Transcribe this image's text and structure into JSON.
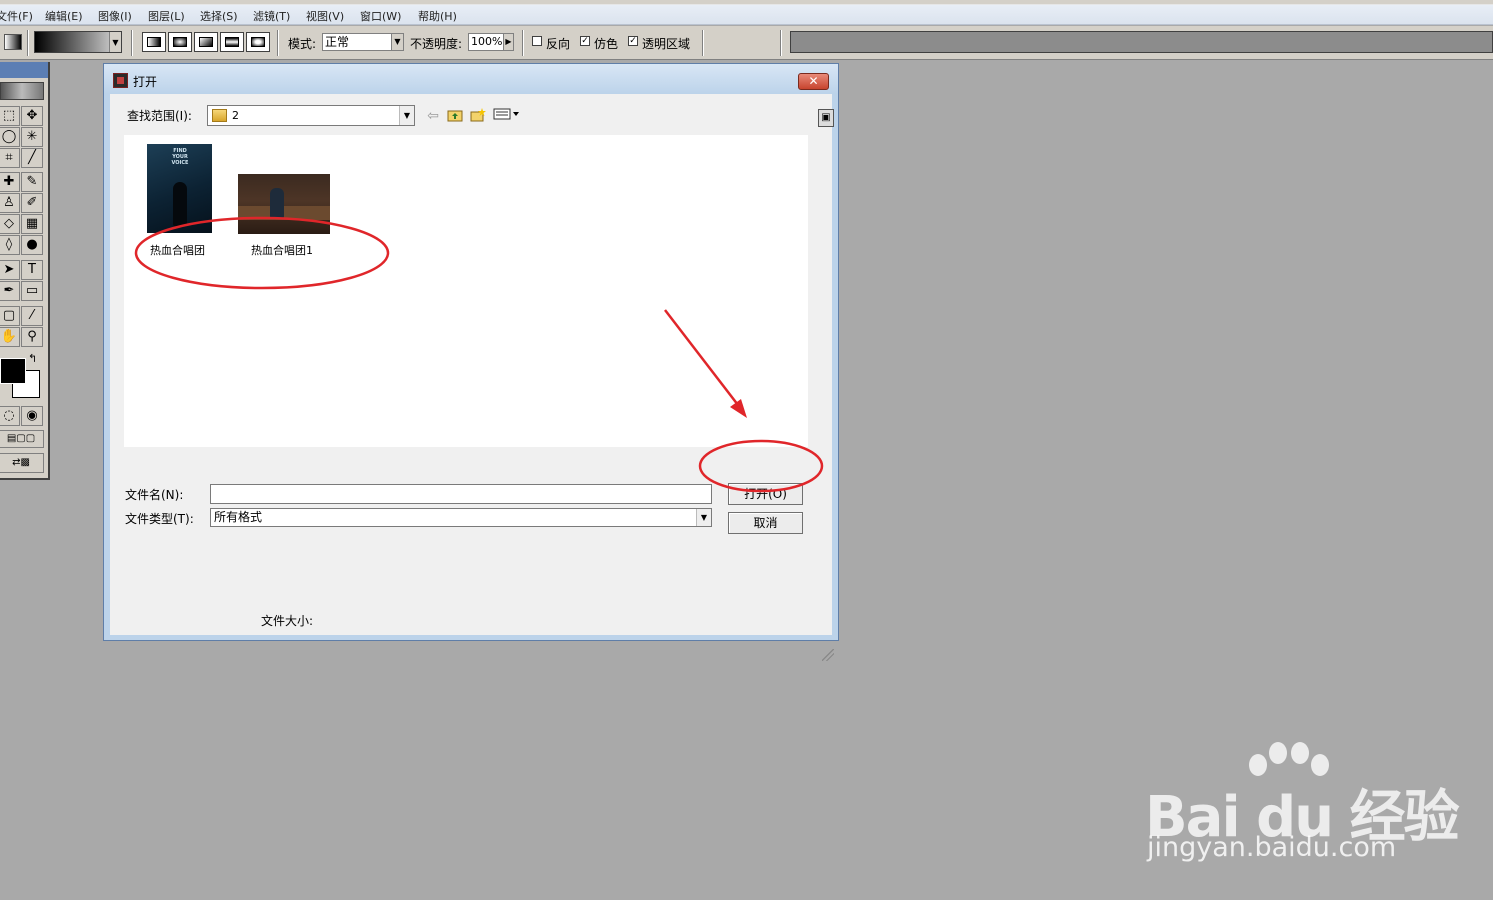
{
  "menubar": {
    "items": [
      "文件(F)",
      "编辑(E)",
      "图像(I)",
      "图层(L)",
      "选择(S)",
      "滤镜(T)",
      "视图(V)",
      "窗口(W)",
      "帮助(H)"
    ]
  },
  "options_bar": {
    "mode_label": "模式:",
    "mode_value": "正常",
    "opacity_label": "不透明度:",
    "opacity_value": "100%",
    "reverse_label": "反向",
    "dither_label": "仿色",
    "transparency_label": "透明区域",
    "reverse_checked": false,
    "dither_checked": true,
    "transparency_checked": true
  },
  "toolbox": {
    "tools": [
      "marquee-icon",
      "move-icon",
      "lasso-icon",
      "magic-wand-icon",
      "crop-icon",
      "eyedropper-slice-icon",
      "healing-icon",
      "brush-icon",
      "stamp-icon",
      "history-brush-icon",
      "eraser-icon",
      "gradient-icon",
      "blur-icon",
      "dodge-icon",
      "path-select-icon",
      "type-icon",
      "pen-icon",
      "rectangle-icon",
      "notes-icon",
      "eyedropper-icon",
      "hand-icon",
      "zoom-icon"
    ],
    "foreground_color": "#000000",
    "background_color": "#ffffff"
  },
  "dialog": {
    "title": "打开",
    "close_glyph": "✕",
    "look_in_label": "查找范围(I):",
    "look_in_value": "2",
    "files": [
      {
        "name": "热血合唱团",
        "poster_text": "FIND YOUR VOICE"
      },
      {
        "name": "热血合唱团1"
      }
    ],
    "filename_label": "文件名(N):",
    "filename_value": "",
    "filetype_label": "文件类型(T):",
    "filetype_value": "所有格式",
    "open_button": "打开(O)",
    "cancel_button": "取消",
    "filesize_label": "文件大小:"
  },
  "annotations": {
    "color": "#e0262a"
  },
  "watermark": {
    "logo_text": "Bai du 经验",
    "url": "jingyan.baidu.com"
  }
}
